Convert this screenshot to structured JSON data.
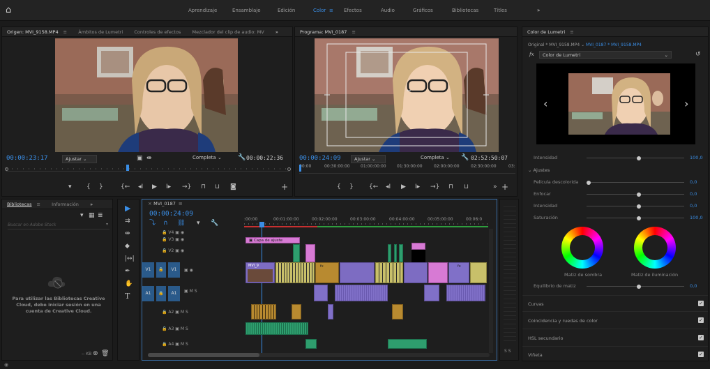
{
  "workspaces": [
    "Aprendizaje",
    "Ensamblaje",
    "Edición",
    "Color",
    "Efectos",
    "Audio",
    "Gráficos",
    "Bibliotecas",
    "Títles"
  ],
  "workspace_active": "Color",
  "more_chevron": "»",
  "source": {
    "tabs": [
      "Origen: MVI_9158.MP4",
      "Ámbitos de Lumetri",
      "Controles de efectos",
      "Mezclador del clip de audio: MV"
    ],
    "timecode": "00:00:23:17",
    "fit": "Ajustar",
    "quality": "Completa",
    "duration": "00:00:22:36"
  },
  "program": {
    "tab": "Programa: MVI_0187",
    "timecode": "00:00:24:09",
    "fit": "Ajustar",
    "quality": "Completa",
    "duration": "02:52:50:07",
    "ruler": [
      "00:00",
      "00:30:00:00",
      "01:00:00:00",
      "01:30:00:00",
      "02:00:00:00",
      "02:30:00:00",
      "03:"
    ]
  },
  "libraries": {
    "tabs": [
      "Bibliotecas",
      "Información"
    ],
    "search_placeholder": "Buscar en Adobe Stock",
    "message": "Para utilizar las Bibliotecas Creative Cloud, debe iniciar sesión en una cuenta de Creative Cloud.",
    "footer": "-- KB"
  },
  "timeline": {
    "tab": "MVI_0187",
    "timecode": "00:00:24:09",
    "ruler": [
      ":00:00",
      "00:01:00:00",
      "00:02:00:00",
      "00:03:00:00",
      "00:04:00:00",
      "00:05:00:00",
      "00:06:0"
    ],
    "adjustment_layer": "Capa de ajuste",
    "clip_label": "MVI_9",
    "fx": "fx",
    "tracks_video": [
      {
        "name": "V4"
      },
      {
        "name": "V3"
      },
      {
        "name": "V2"
      },
      {
        "name": "V1",
        "source": "V1"
      }
    ],
    "tracks_audio": [
      {
        "name": "A1",
        "source": "A1"
      },
      {
        "name": "A2"
      },
      {
        "name": "A3"
      },
      {
        "name": "A4"
      }
    ],
    "track_m": "M",
    "track_s": "S",
    "meter_labels": "S S"
  },
  "lumetri": {
    "title": "Color de Lumetri",
    "clip_path_master": "Original * MVI_9158.MP4",
    "clip_path_seq": "MVI_0187 * MVI_9158.MP4",
    "effect": "Color de Lumetri",
    "intensity_label": "Intensidad",
    "intensity_value": "100,0",
    "adjustments": "Ajustes",
    "faded_film": "Película descolorida",
    "faded_film_value": "0,0",
    "sharpen": "Enfocar",
    "sharpen_value": "0,0",
    "vibrance": "Intensidad",
    "vibrance_value": "0,0",
    "saturation": "Saturación",
    "saturation_value": "100,0",
    "shadow_tint": "Matiz de sombra",
    "highlight_tint": "Matiz de iluminación",
    "tint_balance": "Equilibrio de matiz",
    "tint_balance_value": "0,0",
    "sections": [
      "Curvas",
      "Coincidencia y ruedas de color",
      "HSL secundario",
      "Viñeta"
    ]
  },
  "colors": {
    "accent": "#3a8ee6",
    "panel": "#1e1e1e"
  }
}
